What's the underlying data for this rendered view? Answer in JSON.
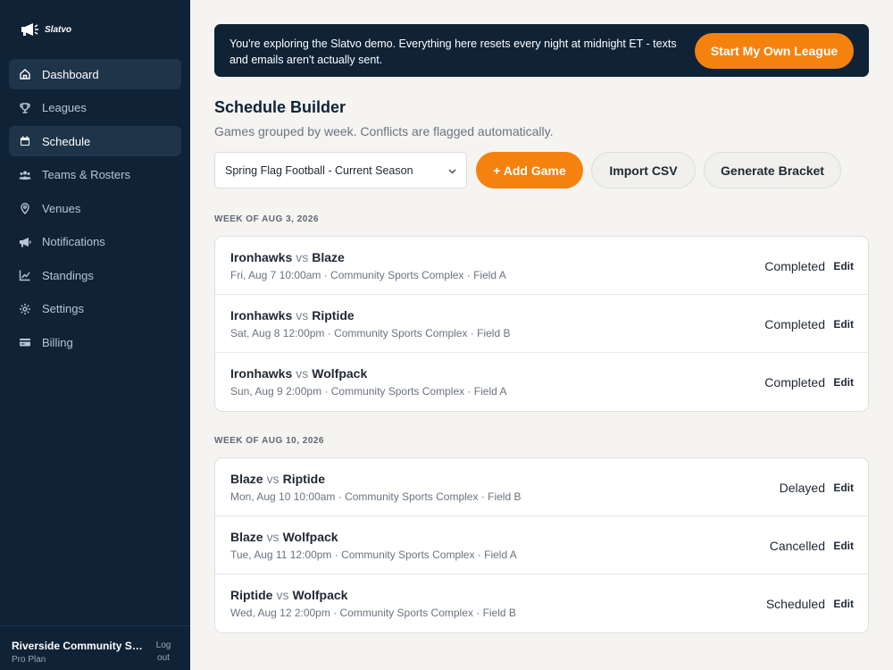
{
  "brand": {
    "name": "Slatvo"
  },
  "sidebar": {
    "items": [
      {
        "label": "Dashboard",
        "icon": "home-icon",
        "active": true
      },
      {
        "label": "Leagues",
        "icon": "trophy-icon",
        "active": false
      },
      {
        "label": "Schedule",
        "icon": "calendar-icon",
        "active": true
      },
      {
        "label": "Teams & Rosters",
        "icon": "users-icon",
        "active": false
      },
      {
        "label": "Venues",
        "icon": "map-pin-icon",
        "active": false
      },
      {
        "label": "Notifications",
        "icon": "megaphone-icon",
        "active": false
      },
      {
        "label": "Standings",
        "icon": "chart-icon",
        "active": false
      },
      {
        "label": "Settings",
        "icon": "gear-icon",
        "active": false
      },
      {
        "label": "Billing",
        "icon": "credit-card-icon",
        "active": false
      }
    ],
    "org_name": "Riverside Community Sports League",
    "plan": "Pro Plan",
    "logout_label": "Log out"
  },
  "banner": {
    "text": "You're exploring the Slatvo demo. Everything here resets every night at midnight ET - texts and emails aren't actually sent.",
    "cta_label": "Start My Own League"
  },
  "page": {
    "title": "Schedule Builder",
    "subtitle": "Games grouped by week. Conflicts are flagged automatically."
  },
  "toolbar": {
    "season_selected": "Spring Flag Football - Current Season",
    "add_game_label": "+ Add Game",
    "import_label": "Import CSV",
    "bracket_label": "Generate Bracket"
  },
  "edit_label": "Edit",
  "vs_label": "vs",
  "weeks": [
    {
      "label": "WEEK OF AUG 3, 2026",
      "games": [
        {
          "home": "Ironhawks",
          "away": "Blaze",
          "details": "Fri, Aug 7 10:00am · Community Sports Complex · Field A",
          "status": "Completed"
        },
        {
          "home": "Ironhawks",
          "away": "Riptide",
          "details": "Sat, Aug 8 12:00pm · Community Sports Complex · Field B",
          "status": "Completed"
        },
        {
          "home": "Ironhawks",
          "away": "Wolfpack",
          "details": "Sun, Aug 9 2:00pm · Community Sports Complex · Field A",
          "status": "Completed"
        }
      ]
    },
    {
      "label": "WEEK OF AUG 10, 2026",
      "games": [
        {
          "home": "Blaze",
          "away": "Riptide",
          "details": "Mon, Aug 10 10:00am · Community Sports Complex · Field B",
          "status": "Delayed"
        },
        {
          "home": "Blaze",
          "away": "Wolfpack",
          "details": "Tue, Aug 11 12:00pm · Community Sports Complex · Field A",
          "status": "Cancelled"
        },
        {
          "home": "Riptide",
          "away": "Wolfpack",
          "details": "Wed, Aug 12 2:00pm · Community Sports Complex · Field B",
          "status": "Scheduled"
        }
      ]
    }
  ],
  "colors": {
    "sidebar": "#0f2236",
    "accent": "#f5820f",
    "background": "#f5f4f1"
  }
}
